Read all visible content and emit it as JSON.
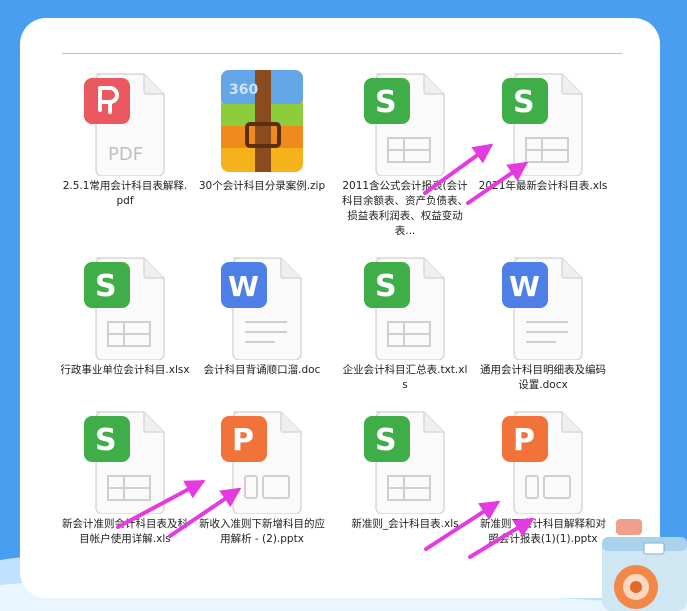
{
  "files": [
    {
      "name": "2.5.1常用会计科目表解释.pdf",
      "type": "pdf",
      "icon": "pdf-file-icon"
    },
    {
      "name": "30个会计科目分录案例.zip",
      "type": "zip",
      "icon": "zip-archive-icon"
    },
    {
      "name": "2011含公式会计报表(会计科目余额表、资产负债表、损益表利润表、权益变动表...",
      "type": "xls",
      "icon": "spreadsheet-file-icon"
    },
    {
      "name": "2021年最新会计科目表.xls",
      "type": "xls",
      "icon": "spreadsheet-file-icon"
    },
    {
      "name": "行政事业单位会计科目.xlsx",
      "type": "xls",
      "icon": "spreadsheet-file-icon"
    },
    {
      "name": "会计科目背诵顺口溜.doc",
      "type": "doc",
      "icon": "word-file-icon"
    },
    {
      "name": "企业会计科目汇总表.txt.xls",
      "type": "xls",
      "icon": "spreadsheet-file-icon"
    },
    {
      "name": "通用会计科目明细表及编码设置.docx",
      "type": "doc",
      "icon": "word-file-icon"
    },
    {
      "name": "新会计准则会计科目表及科目帐户使用详解.xls",
      "type": "xls",
      "icon": "spreadsheet-file-icon"
    },
    {
      "name": "新收入准则下新增科目的应用解析 - (2).pptx",
      "type": "ppt",
      "icon": "presentation-file-icon"
    },
    {
      "name": "新准则_会计科目表.xls",
      "type": "xls",
      "icon": "spreadsheet-file-icon"
    },
    {
      "name": "新准则下会计科目解释和对照会计报表(1)(1).pptx",
      "type": "ppt",
      "icon": "presentation-file-icon"
    }
  ],
  "colors": {
    "background": "#4a9ef0",
    "card": "#ffffff",
    "sheet_green": "#3fae49",
    "word_blue": "#4e7fe6",
    "ppt_orange": "#f2733a",
    "pdf_red": "#e9595f",
    "arrow_magenta": "#e33be0"
  }
}
